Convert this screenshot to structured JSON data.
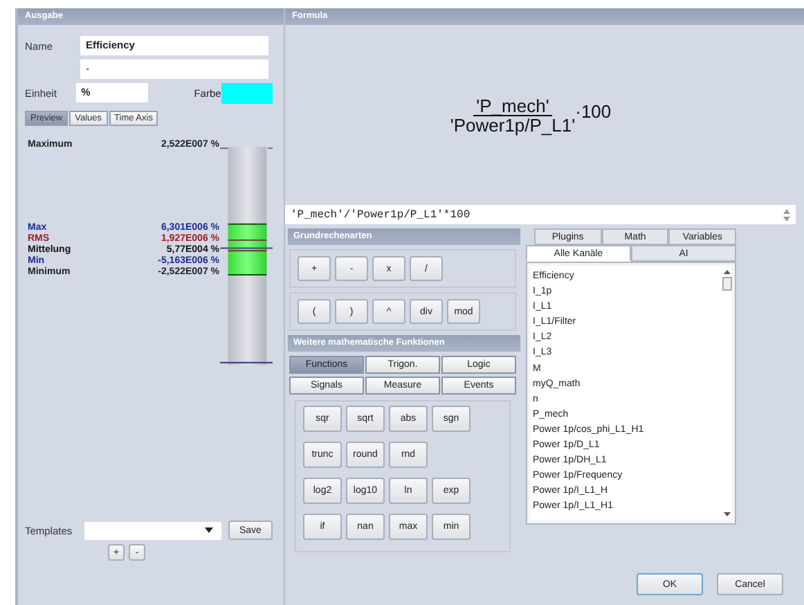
{
  "output_panel": {
    "title": "Ausgabe",
    "name_label": "Name",
    "name_value": "Efficiency",
    "description_value": "-",
    "unit_label": "Einheit",
    "unit_value": "%",
    "color_label": "Farbe",
    "color": "#00ffff",
    "tabs": [
      {
        "label": "Preview",
        "selected": true
      },
      {
        "label": "Values",
        "selected": false
      },
      {
        "label": "Time Axis",
        "selected": false
      }
    ],
    "preview": {
      "maximum": {
        "label": "Maximum",
        "value": "2,522E007 %"
      },
      "stats": [
        {
          "label": "Max",
          "value": "6,301E006 %",
          "color": "#1e2a8c"
        },
        {
          "label": "RMS",
          "value": "1,927E006 %",
          "color": "#a01c1c"
        },
        {
          "label": "Mittelung",
          "value": "5,77E004 %",
          "color": "#111111"
        },
        {
          "label": "Min",
          "value": "-5,163E006 %",
          "color": "#1e2a8c"
        }
      ],
      "minimum": {
        "label": "Minimum",
        "value": "-2,522E007 %"
      }
    },
    "templates": {
      "label": "Templates",
      "save_button": "Save",
      "add_button": "+",
      "remove_button": "-"
    }
  },
  "formula_panel": {
    "title": "Formula",
    "numerator": "'P_mech'",
    "denominator": "'Power1p/P_L1'",
    "factor": "·100",
    "input_value": "'P_mech'/'Power1p/P_L1'*100"
  },
  "basic_arithmetic": {
    "title": "Grundrechenarten",
    "rows": [
      [
        "+",
        "-",
        "x",
        "/"
      ],
      [
        "(",
        ")",
        "^",
        "div",
        "mod"
      ]
    ]
  },
  "more_functions": {
    "title": "Weitere mathematische Funktionen",
    "tabs": [
      [
        {
          "label": "Functions",
          "selected": true
        },
        {
          "label": "Trigon.",
          "selected": false
        },
        {
          "label": "Logic",
          "selected": false
        }
      ],
      [
        {
          "label": "Signals",
          "selected": false
        },
        {
          "label": "Measure",
          "selected": false
        },
        {
          "label": "Events",
          "selected": false
        }
      ]
    ],
    "rows": [
      [
        "sqr",
        "sqrt",
        "abs",
        "sgn"
      ],
      [
        "trunc",
        "round",
        "rnd"
      ],
      [
        "log2",
        "log10",
        "ln",
        "exp"
      ],
      [
        "if",
        "nan",
        "max",
        "min"
      ]
    ]
  },
  "channel_tabs": {
    "row_1": [
      {
        "label": "Plugins",
        "selected": false
      },
      {
        "label": "Math",
        "selected": false
      },
      {
        "label": "Variables",
        "selected": false
      }
    ],
    "row_2": [
      {
        "label": "Alle Kanäle",
        "selected": true
      },
      {
        "label": "AI",
        "selected": false
      }
    ],
    "items": [
      "Efficiency",
      "I_1p",
      "I_L1",
      "I_L1/Filter",
      "I_L2",
      "I_L3",
      "M",
      "myQ_math",
      "n",
      "P_mech",
      "Power 1p/cos_phi_L1_H1",
      "Power 1p/D_L1",
      "Power 1p/DH_L1",
      "Power 1p/Frequency",
      "Power 1p/I_L1_H",
      "Power 1p/I_L1_H1"
    ]
  },
  "buttons": {
    "ok": "OK",
    "cancel": "Cancel"
  }
}
